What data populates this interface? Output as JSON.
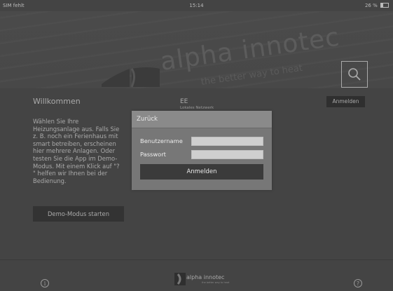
{
  "status_bar": {
    "carrier": "SIM fehlt",
    "time": "15:14",
    "battery": "26 %"
  },
  "header": {
    "logo_text": "alpha innotec",
    "tagline": "the better way to heat",
    "icons": {
      "search": "search-icon"
    }
  },
  "welcome": {
    "title": "Willkommen",
    "text": "Wählen Sie Ihre\nHeizungsanlage aus. Falls Sie\nz. B. noch ein Ferienhaus mit\nsmart betreiben, erscheinen\nhier mehrere Anlagen. Oder\ntesten Sie die App im Demo-\nModus. Mit einem Klick auf \"?\n\" helfen wir Ihnen bei der\nBedienung.",
    "demo_button": "Demo-Modus starten"
  },
  "plant": {
    "name": "EE",
    "network": "Lokales Netzwerk"
  },
  "top_login_button": "Anmelden",
  "login_dialog": {
    "back_label": "Zurück",
    "username_label": "Benutzername",
    "password_label": "Passwort",
    "username_value": "",
    "password_value": "",
    "submit_label": "Anmelden"
  },
  "footer": {
    "logo_text": "alpha innotec",
    "tagline": "the better way to heat",
    "info_icon": "info-icon",
    "help_icon": "help-icon",
    "info_glyph": "i",
    "help_glyph": "?"
  },
  "colors": {
    "background": "#444444",
    "dialog": "#777777",
    "button_dark": "#3b3b3b"
  }
}
